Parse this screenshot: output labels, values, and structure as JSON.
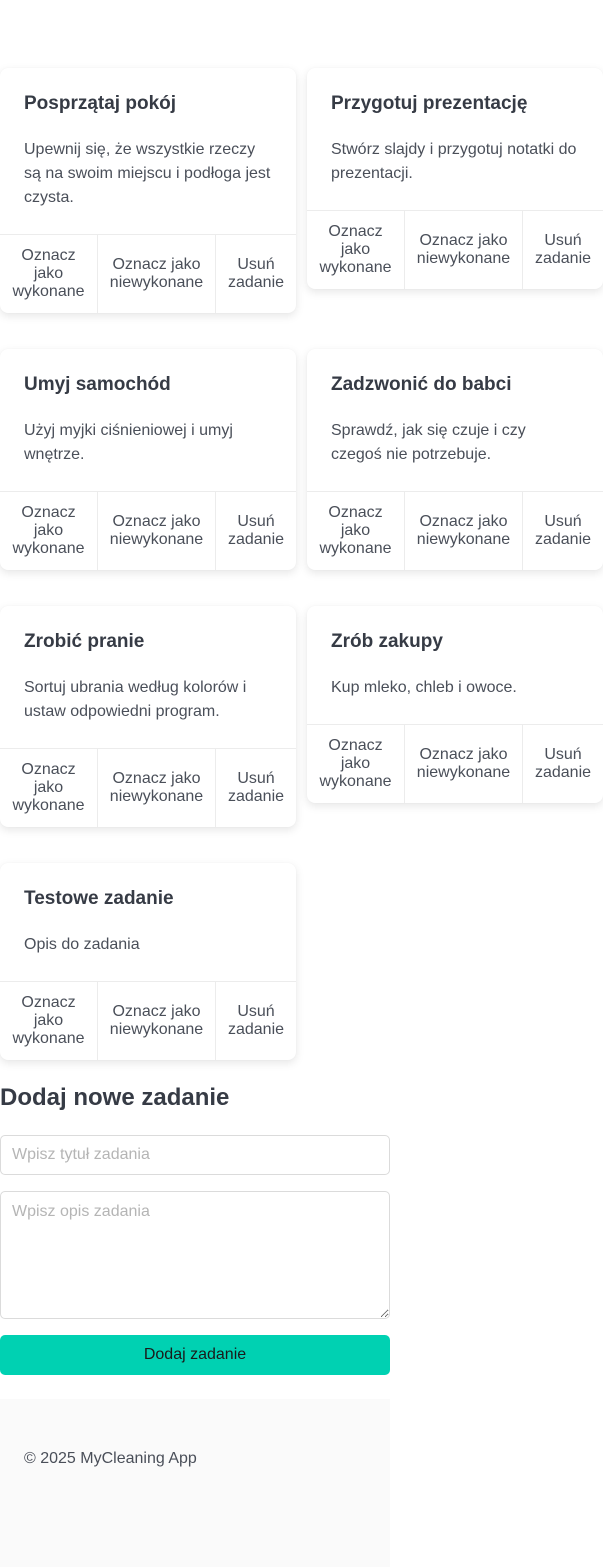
{
  "tasks": [
    {
      "title": "Posprzątaj pokój",
      "description": "Upewnij się, że wszystkie rzeczy są na swoim miejscu i podłoga jest czysta."
    },
    {
      "title": "Przygotuj prezentację",
      "description": "Stwórz slajdy i przygotuj notatki do prezentacji."
    },
    {
      "title": "Umyj samochód",
      "description": "Użyj myjki ciśnieniowej i umyj wnętrze."
    },
    {
      "title": "Zadzwonić do babci",
      "description": "Sprawdź, jak się czuje i czy czegoś nie potrzebuje."
    },
    {
      "title": "Zrobić pranie",
      "description": "Sortuj ubrania według kolorów i ustaw odpowiedni program."
    },
    {
      "title": "Zrób zakupy",
      "description": "Kup mleko, chleb i owoce."
    },
    {
      "title": "Testowe zadanie",
      "description": "Opis do zadania"
    }
  ],
  "actions": {
    "mark_done": "Oznacz jako wykonane",
    "mark_undone": "Oznacz jako niewykonane",
    "delete": "Usuń zadanie"
  },
  "add_form": {
    "heading": "Dodaj nowe zadanie",
    "title_placeholder": "Wpisz tytuł zadania",
    "description_placeholder": "Wpisz opis zadania",
    "submit_label": "Dodaj zadanie"
  },
  "footer": {
    "copyright": "© 2025 MyCleaning App"
  },
  "colors": {
    "primary": "#00d1b2",
    "text": "#363b45"
  }
}
